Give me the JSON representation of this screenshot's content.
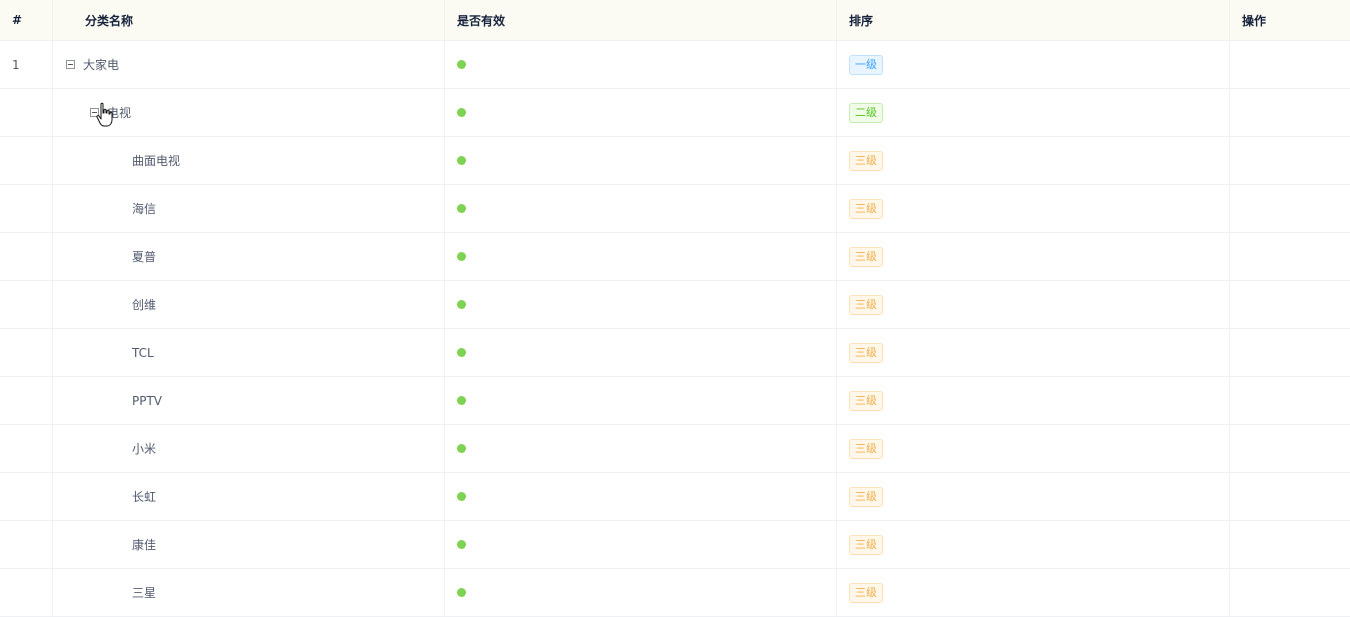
{
  "table": {
    "headers": {
      "index": "#",
      "name": "分类名称",
      "valid": "是否有效",
      "sort": "排序",
      "action": "操作"
    },
    "rows": [
      {
        "index": "1",
        "name": "大家电",
        "level": "一级",
        "valid": true,
        "expanded": true
      },
      {
        "index": "",
        "name": "电视",
        "level": "二级",
        "valid": true,
        "expanded": true
      },
      {
        "index": "",
        "name": "曲面电视",
        "level": "三级",
        "valid": true
      },
      {
        "index": "",
        "name": "海信",
        "level": "三级",
        "valid": true
      },
      {
        "index": "",
        "name": "夏普",
        "level": "三级",
        "valid": true
      },
      {
        "index": "",
        "name": "创维",
        "level": "三级",
        "valid": true
      },
      {
        "index": "",
        "name": "TCL",
        "level": "三级",
        "valid": true
      },
      {
        "index": "",
        "name": "PPTV",
        "level": "三级",
        "valid": true
      },
      {
        "index": "",
        "name": "小米",
        "level": "三级",
        "valid": true
      },
      {
        "index": "",
        "name": "长虹",
        "level": "三级",
        "valid": true
      },
      {
        "index": "",
        "name": "康佳",
        "level": "三级",
        "valid": true
      },
      {
        "index": "",
        "name": "三星",
        "level": "三级",
        "valid": true
      }
    ]
  },
  "icons": {
    "toggle": "collapse-square-icon",
    "valid": "valid-dot-icon",
    "cursor": "hand-pointer-icon"
  },
  "colors": {
    "valid": "#52c41a",
    "level1": "#3a9ff8",
    "level2": "#52c41a",
    "level3": "#f0ad4e"
  }
}
